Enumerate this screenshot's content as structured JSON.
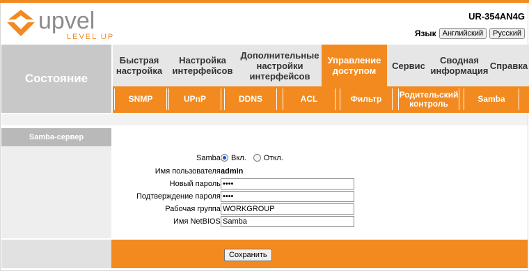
{
  "header": {
    "brand": "upvel",
    "tagline": "LEVEL UP",
    "model": "UR-354AN4G",
    "language_label": "Язык",
    "lang_buttons": [
      "Английский",
      "Русский"
    ]
  },
  "state_label": "Состояние",
  "main_nav": [
    {
      "label": "Быстрая настройка"
    },
    {
      "label": "Настройка интерфейсов"
    },
    {
      "label": "Дополнительные настройки интерфейсов"
    },
    {
      "label": "Управление доступом",
      "active": true
    },
    {
      "label": "Сервис"
    },
    {
      "label": "Сводная информация"
    },
    {
      "label": "Справка"
    }
  ],
  "sub_nav": [
    {
      "label": "SNMP"
    },
    {
      "label": "UPnP"
    },
    {
      "label": "DDNS"
    },
    {
      "label": "ACL"
    },
    {
      "label": "Фильтр"
    },
    {
      "label": "Родительский контроль"
    },
    {
      "label": "Samba",
      "active": true
    }
  ],
  "sidebar": {
    "title": "Samba-сервер"
  },
  "form": {
    "samba_label": "Samba :",
    "samba_on": "Вкл.",
    "samba_off": "Откл.",
    "samba_enabled": true,
    "user_label": "Имя пользователя :",
    "user_value": "admin",
    "new_pass_label": "Новый пароль :",
    "new_pass_value": "••••",
    "confirm_pass_label": "Подтверждение пароля :",
    "confirm_pass_value": "••••",
    "workgroup_label": "Рабочая группа :",
    "workgroup_value": "WORKGROUP",
    "netbios_label": "Имя NetBIOS :",
    "netbios_value": "Samba"
  },
  "save_label": "Сохранить",
  "colors": {
    "accent": "#f28a1f",
    "sidebar": "#b9b9b9",
    "panel": "#eeeeee"
  }
}
